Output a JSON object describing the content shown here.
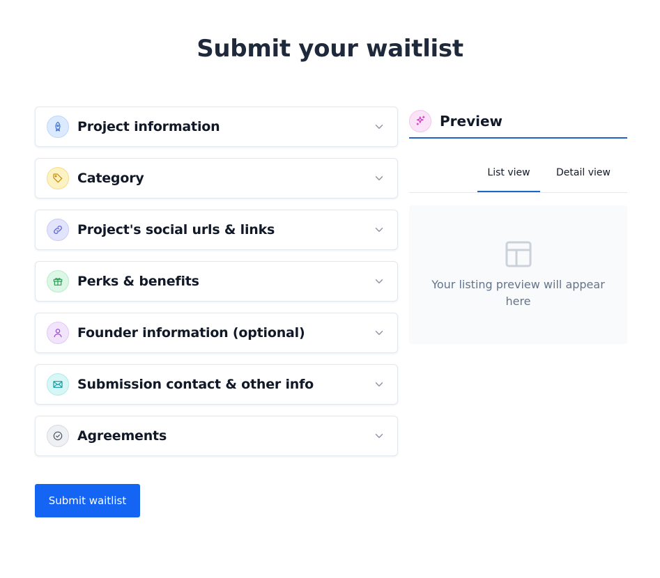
{
  "page": {
    "title": "Submit your waitlist"
  },
  "sections": [
    {
      "label": "Project information",
      "icon": "rocket-icon",
      "bg": "#dbeafe",
      "border": "#bfd5fb",
      "color": "#3b6fd8"
    },
    {
      "label": "Category",
      "icon": "tag-icon",
      "bg": "#fdf2c4",
      "border": "#f5dd8a",
      "color": "#c88a0a"
    },
    {
      "label": "Project's social urls & links",
      "icon": "link-icon",
      "bg": "#e2e4fb",
      "border": "#c9cdf5",
      "color": "#5b5fd6"
    },
    {
      "label": "Perks & benefits",
      "icon": "gift-icon",
      "bg": "#dcf7e6",
      "border": "#b9ecc9",
      "color": "#22a355"
    },
    {
      "label": "Founder information (optional)",
      "icon": "user-icon",
      "bg": "#f1e4fb",
      "border": "#e1c9f5",
      "color": "#9a44d6"
    },
    {
      "label": "Submission contact & other info",
      "icon": "mail-icon",
      "bg": "#d7f7f7",
      "border": "#aeeaea",
      "color": "#0e9aa0"
    },
    {
      "label": "Agreements",
      "icon": "check-circle-icon",
      "bg": "#eef0f3",
      "border": "#d6dbe2",
      "color": "#4b5563"
    }
  ],
  "submit": {
    "label": "Submit waitlist",
    "color": "#1565f5"
  },
  "preview": {
    "title": "Preview",
    "icon": "sparkles-icon",
    "tabs": {
      "list": "List view",
      "detail": "Detail view"
    },
    "active_tab": "List view",
    "placeholder_icon": "layout-icon",
    "placeholder_text": "Your listing preview will appear here"
  }
}
